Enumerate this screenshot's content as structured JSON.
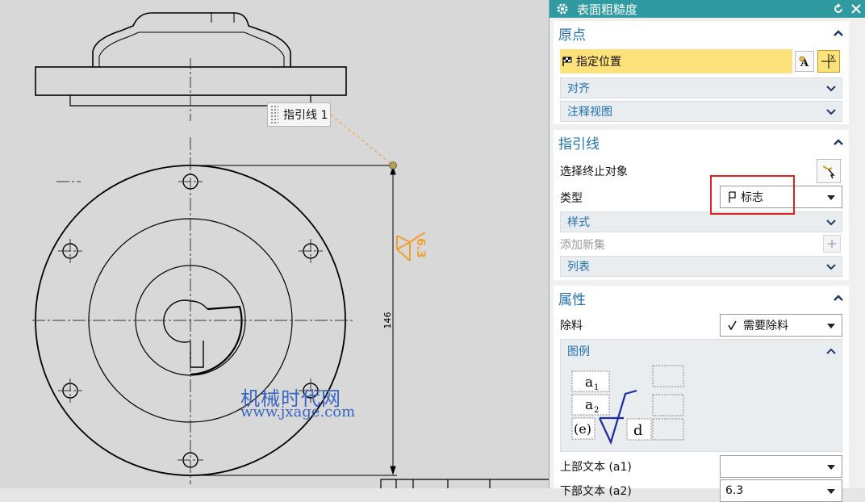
{
  "canvas": {
    "tooltip": "指引线 1",
    "dimension_text": "146",
    "roughness_value": "6.3",
    "watermark_line1": "机械时代网",
    "watermark_line2": "www.jxage.com"
  },
  "dialog": {
    "title": "表面粗糙度",
    "origin": {
      "header": "原点",
      "specify_location": "指定位置",
      "align": "对齐",
      "annotation_view": "注释视图"
    },
    "leader": {
      "header": "指引线",
      "select_end_object": "选择终止对象",
      "type_label": "类型",
      "type_value": "标志",
      "style": "样式",
      "add_new_set": "添加新集",
      "list": "列表"
    },
    "properties": {
      "header": "属性",
      "material_removal_label": "除料",
      "material_removal_value": "需要除料",
      "legend_header": "图例",
      "legend": {
        "a1": "a",
        "a1_sub": "1",
        "a2": "a",
        "a2_sub": "2",
        "e": "(e)",
        "d": "d"
      },
      "upper_text_label": "上部文本 (a1)",
      "upper_text_value": "",
      "lower_text_label": "下部文本 (a2)",
      "lower_text_value": "6.3"
    }
  },
  "colors": {
    "title_bar": "#2f9aa0",
    "section_header_text": "#1f6fae",
    "highlight_row": "#fde27c",
    "annotation_orange": "#f0a030",
    "legend_symbol": "#1a2aa6",
    "red_highlight": "#e02020"
  }
}
